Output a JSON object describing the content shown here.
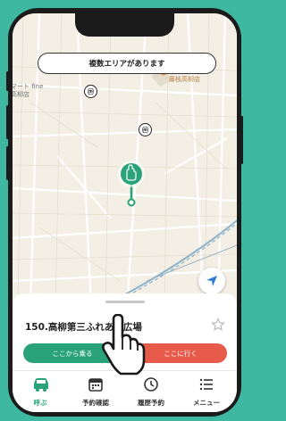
{
  "banner": {
    "text": "複数エリアがあります"
  },
  "map": {
    "labels": {
      "left_place": "マート fine\n高柳店",
      "restaurant": "モトド CURRY\n藤枝高柳店"
    },
    "stop_icon_glyph": "ⓜ"
  },
  "bottom_sheet": {
    "stop_name": "150.高柳第三ふれあい広場",
    "board_button": "ここから乗る",
    "go_button": "ここに行く"
  },
  "tabs": [
    {
      "label": "呼ぶ",
      "icon": "car-icon",
      "active": true
    },
    {
      "label": "予約確認",
      "icon": "calendar-icon",
      "active": false
    },
    {
      "label": "履歴予約",
      "icon": "history-icon",
      "active": false
    },
    {
      "label": "メニュー",
      "icon": "menu-list-icon",
      "active": false
    }
  ],
  "colors": {
    "accent_green": "#2aa37a",
    "go_red": "#e85b4a",
    "background_teal": "#3fb8a2"
  }
}
